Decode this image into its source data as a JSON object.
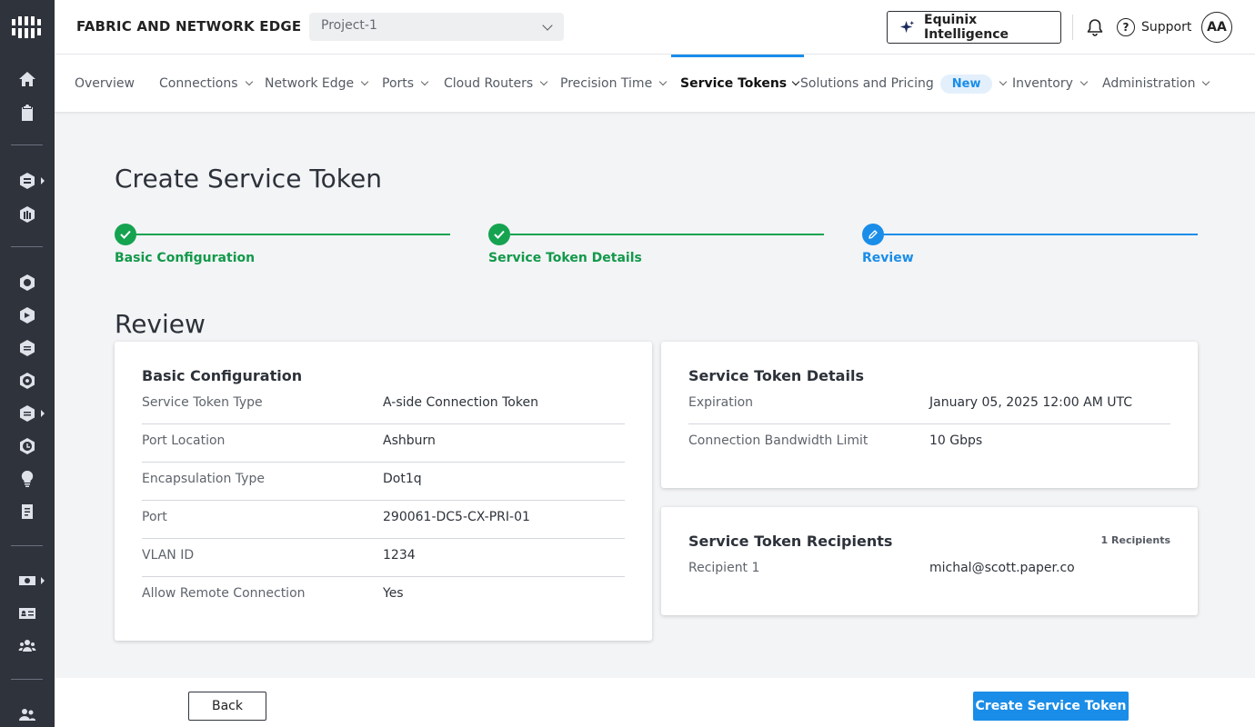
{
  "header": {
    "brand": "FABRIC AND NETWORK EDGE",
    "project": "Project-1",
    "intelligence_label": "Equinix Intelligence",
    "support_label": "Support",
    "avatar_initials": "AA"
  },
  "nav": {
    "items": [
      {
        "label": "Overview"
      },
      {
        "label": "Connections"
      },
      {
        "label": "Network Edge"
      },
      {
        "label": "Ports"
      },
      {
        "label": "Cloud Routers"
      },
      {
        "label": "Precision Time"
      },
      {
        "label": "Service Tokens"
      },
      {
        "label": "Solutions and Pricing"
      },
      {
        "label": "Inventory"
      },
      {
        "label": "Administration"
      }
    ],
    "new_badge": "New",
    "active_item": "Service Tokens"
  },
  "page": {
    "title": "Create Service Token",
    "section_title": "Review"
  },
  "stepper": {
    "steps": [
      {
        "label": "Basic Configuration",
        "state": "complete"
      },
      {
        "label": "Service Token Details",
        "state": "complete"
      },
      {
        "label": "Review",
        "state": "current"
      }
    ]
  },
  "basic_config": {
    "title": "Basic Configuration",
    "rows": [
      {
        "key": "Service Token Type",
        "value": "A-side Connection Token"
      },
      {
        "key": "Port Location",
        "value": "Ashburn"
      },
      {
        "key": "Encapsulation Type",
        "value": "Dot1q"
      },
      {
        "key": "Port",
        "value": "290061-DC5-CX-PRI-01"
      },
      {
        "key": "VLAN ID",
        "value": "1234"
      },
      {
        "key": "Allow Remote Connection",
        "value": "Yes"
      }
    ]
  },
  "token_details": {
    "title": "Service Token Details",
    "rows": [
      {
        "key": "Expiration",
        "value": "January 05, 2025 12:00 AM UTC"
      },
      {
        "key": "Connection Bandwidth Limit",
        "value": "10 Gbps"
      }
    ]
  },
  "recipients": {
    "title": "Service Token Recipients",
    "count_label": "1 Recipients",
    "rows": [
      {
        "key": "Recipient 1",
        "value": "michal@scott.paper.co"
      }
    ]
  },
  "footer": {
    "back_label": "Back",
    "create_label": "Create Service Token"
  },
  "colors": {
    "accent": "#1a8de8",
    "success": "#15a350",
    "rail": "#2f333c"
  },
  "icons": {
    "rail": [
      "equinix-logo-icon",
      "home-icon",
      "clipboard-icon",
      "fabric-icon",
      "network-edge-icon",
      "connections-icon",
      "ports-icon",
      "cloud-router-icon",
      "network-icon",
      "precision-time-icon",
      "lightbulb-icon",
      "document-icon",
      "billing-icon",
      "id-card-icon",
      "users-icon",
      "team-icon"
    ]
  }
}
